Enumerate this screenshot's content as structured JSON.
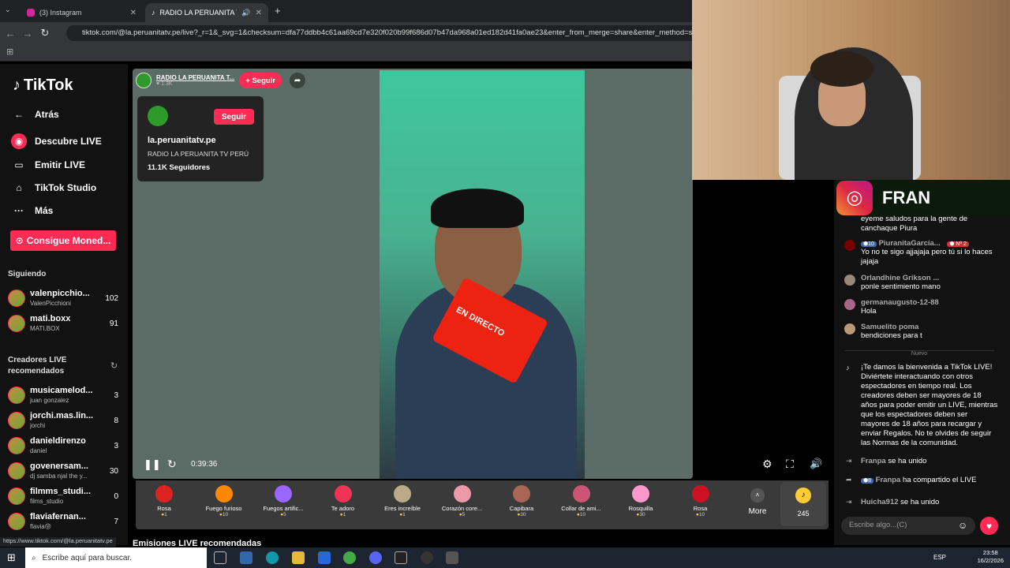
{
  "browser": {
    "tab1": "(3) Instagram",
    "tab2": "RADIO LA PERUANITA TV P",
    "url": "tiktok.com/@la.peruanitatv.pe/live?_r=1&_svg=1&checksum=dfa77ddbb4c61aa69cd7e320f020b99f686d07b47da968a01ed182d41fa0ae23&enter_from_merge=share&enter_method=shar",
    "status_url": "https://www.tiktok.com/@la.peruanitatv.pe"
  },
  "sidebar": {
    "logo": "TikTok",
    "back": "Atrás",
    "discover": "Descubre LIVE",
    "emit": "Emitir LIVE",
    "studio": "TikTok Studio",
    "more": "Más",
    "coins": "Consigue Moned...",
    "following_title": "Siguiendo",
    "recommended_title": "Creadores LIVE recomendados",
    "following": [
      {
        "name": "valenpicchio...",
        "sub": "ValenPicchioni",
        "count": "102"
      },
      {
        "name": "mati.boxx",
        "sub": "MATI.BOX",
        "count": "91"
      }
    ],
    "recommended": [
      {
        "name": "musicamelod...",
        "sub": "juan gonzalez",
        "count": "3"
      },
      {
        "name": "jorchi.mas.lin...",
        "sub": "jorchi",
        "count": "8"
      },
      {
        "name": "danieldirenzo",
        "sub": "daniel",
        "count": "3"
      },
      {
        "name": "govenersam...",
        "sub": "dj samba njal the y...",
        "count": "30"
      },
      {
        "name": "filmms_studi...",
        "sub": "films_studio",
        "count": "0"
      },
      {
        "name": "flaviafernan...",
        "sub": "flavia😝",
        "count": "7"
      }
    ]
  },
  "live": {
    "host_name": "RADIO LA PERUANITA T...",
    "host_likes": "1.3K",
    "follow": "+ Seguir",
    "time": "0:39:36",
    "mic_label": "EN DIRECTO"
  },
  "card": {
    "follow": "Seguir",
    "username": "la.peruanitatv.pe",
    "display": "RADIO LA PERUANITA TV PERÚ",
    "followers": "11.1K Seguidores"
  },
  "gifts": [
    {
      "name": "Rosa",
      "price": "1",
      "color": "#d22"
    },
    {
      "name": "Fuego furioso",
      "price": "10",
      "color": "#f80"
    },
    {
      "name": "Fuegos artific...",
      "price": "5",
      "color": "#96f"
    },
    {
      "name": "Te adoro",
      "price": "1",
      "color": "#e35"
    },
    {
      "name": "Eres increíble",
      "price": "1",
      "color": "#ba8"
    },
    {
      "name": "Corazón core...",
      "price": "5",
      "color": "#e9a"
    },
    {
      "name": "Capibara",
      "price": "30",
      "color": "#a65"
    },
    {
      "name": "Collar de ami...",
      "price": "10",
      "color": "#c57"
    },
    {
      "name": "Rosquilla",
      "price": "30",
      "color": "#f9c"
    },
    {
      "name": "Rosa",
      "price": "10",
      "color": "#c12"
    }
  ],
  "gift_more": "More",
  "coins_balance": "245",
  "banner": {
    "text": "FRAN"
  },
  "chat": [
    {
      "user": "",
      "text": "eyeme saludos para la gente de canchaque Piura"
    },
    {
      "user": "PiuranitaGarcía...",
      "level": "10",
      "rank": "Nº 2",
      "text": "Yo no te sigo ajjajaja pero tú si lo haces jajaja"
    },
    {
      "user": "Orlandhine Grikson ...",
      "text": "ponle sentimiento mano"
    },
    {
      "user": "germanaugusto-12-88",
      "text": "Hola"
    },
    {
      "user": "Samuelito poma",
      "text": "bendiciones para t"
    }
  ],
  "chat_divider": "Nuevo",
  "welcome": "¡Te damos la bienvenida a TikTok LIVE! Diviértete interactuando con otros espectadores en tiempo real. Los creadores deben ser mayores de 18 años para poder emitir un LIVE, mientras que los espectadores deben ser mayores de 18 años para recargar y enviar Regalos. No te olvides de seguir las Normas de la comunidad.",
  "events": [
    {
      "user": "Franpa",
      "text": "se ha unido"
    },
    {
      "user": "Franpa",
      "level": "8",
      "text": "ha compartido el LIVE"
    },
    {
      "user": "Huicha912",
      "text": "se ha unido"
    }
  ],
  "chat_input": "Escribe algo...(C)",
  "recommended_heading": "Emisiones LIVE recomendadas",
  "taskbar": {
    "search": "Escribe aquí para buscar.",
    "lang": "ESP",
    "time": "23:58",
    "date": "16/2/2026"
  }
}
